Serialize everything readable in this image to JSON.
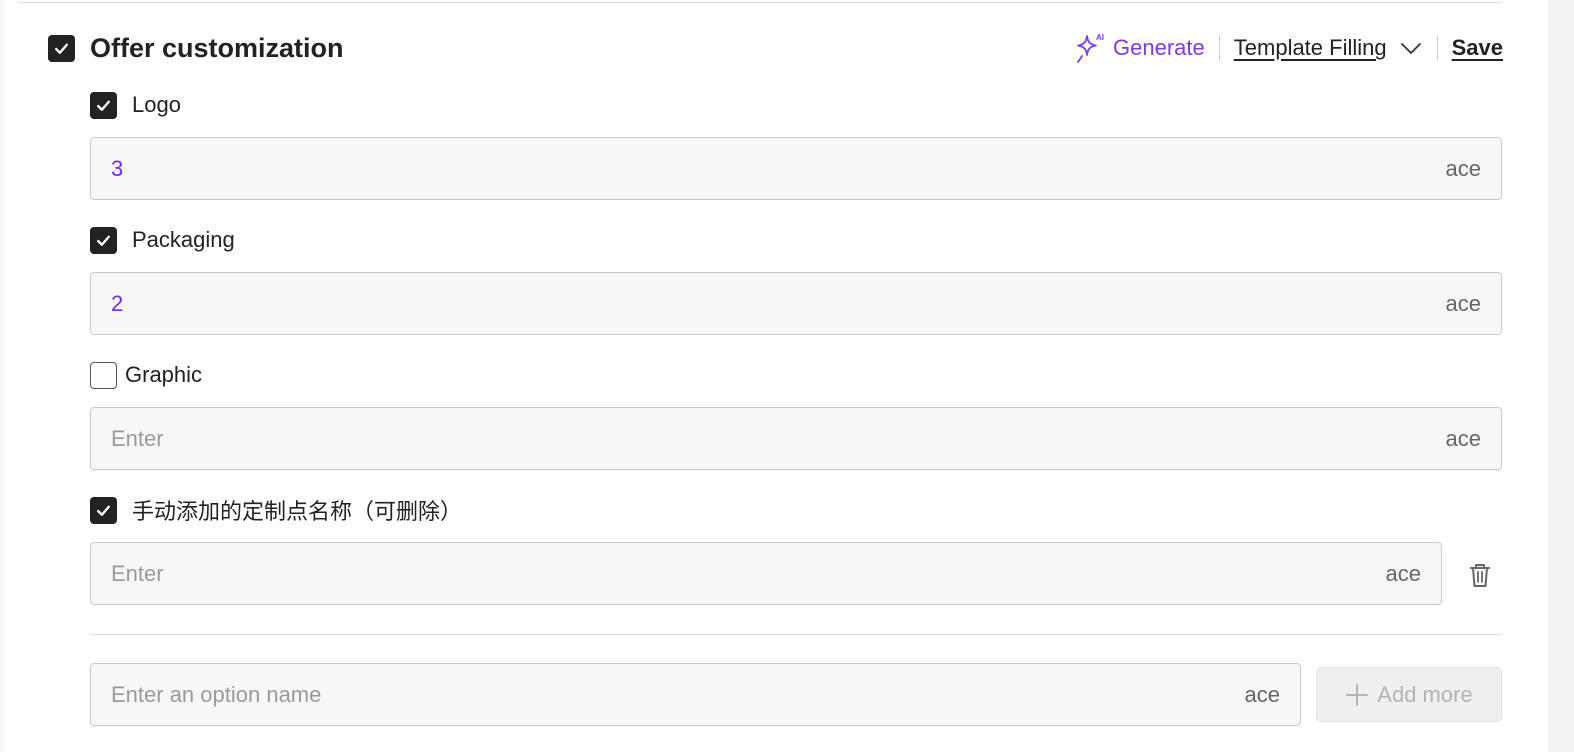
{
  "section": {
    "title": "Offer customization",
    "checked": true
  },
  "actions": {
    "generate_badge": "AI",
    "generate_label": "Generate",
    "template_label": "Template Filling",
    "save_label": "Save"
  },
  "options": [
    {
      "label": "Logo",
      "checked": true,
      "value": "3",
      "placeholder": "",
      "suffix": "ace"
    },
    {
      "label": "Packaging",
      "checked": true,
      "value": "2",
      "placeholder": "",
      "suffix": "ace"
    },
    {
      "label": "Graphic",
      "checked": false,
      "value": "",
      "placeholder": "Enter",
      "suffix": "ace"
    },
    {
      "label": "手动添加的定制点名称（可删除）",
      "checked": true,
      "value": "",
      "placeholder": "Enter",
      "suffix": "ace",
      "deletable": true
    }
  ],
  "new_option": {
    "placeholder": "Enter an option name",
    "suffix": "ace",
    "add_label": "Add more"
  },
  "colors": {
    "accent": "#7a3cf0",
    "value_text": "#6a2ee8",
    "checkbox": "#222222"
  },
  "icons": {
    "generate": "sparkle-ai-icon",
    "template_toggle": "chevron-down-icon",
    "delete": "trash-icon",
    "add": "plus-icon",
    "check": "check-icon"
  }
}
